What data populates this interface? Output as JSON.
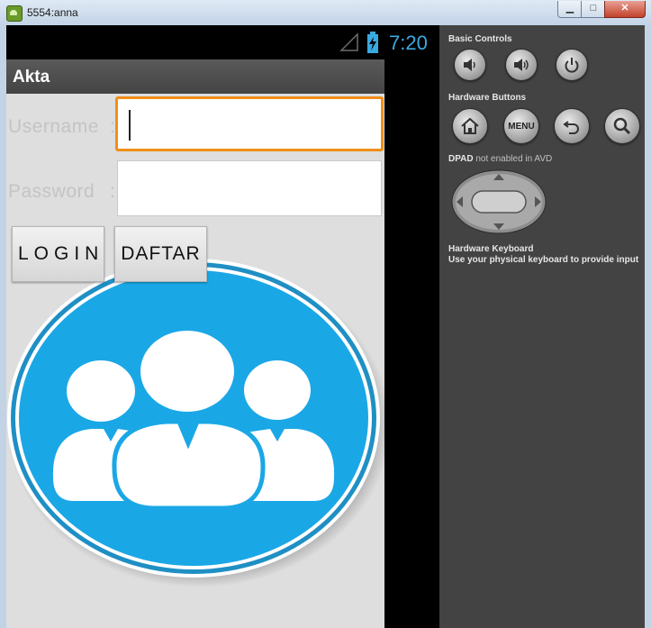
{
  "window": {
    "title": "5554:anna",
    "minimize_glyph": "▁",
    "maximize_glyph": "□",
    "close_glyph": "✕"
  },
  "status_bar": {
    "time": "7:20",
    "icons": [
      "signal-icon",
      "battery-charging-icon"
    ]
  },
  "app": {
    "title": "Akta",
    "username_label": "Username",
    "password_label": "Password",
    "colon": ":",
    "username_value": "",
    "password_value": "",
    "login_button": "LOGIN",
    "register_button": "DAFTAR",
    "logo": "users-group-logo",
    "accent_color": "#1aa7e6"
  },
  "controls": {
    "basic_controls_title": "Basic Controls",
    "hardware_buttons_title": "Hardware Buttons",
    "dpad_title": "DPAD",
    "dpad_note": "not enabled in AVD",
    "hardware_keyboard_title": "Hardware Keyboard",
    "hardware_keyboard_desc": "Use your physical keyboard to provide input",
    "menu_label": "MENU",
    "basic_icons": [
      "volume-down-icon",
      "volume-up-icon",
      "power-icon"
    ],
    "hardware_icons": [
      "home-icon",
      "menu-icon",
      "back-icon",
      "search-icon"
    ]
  }
}
